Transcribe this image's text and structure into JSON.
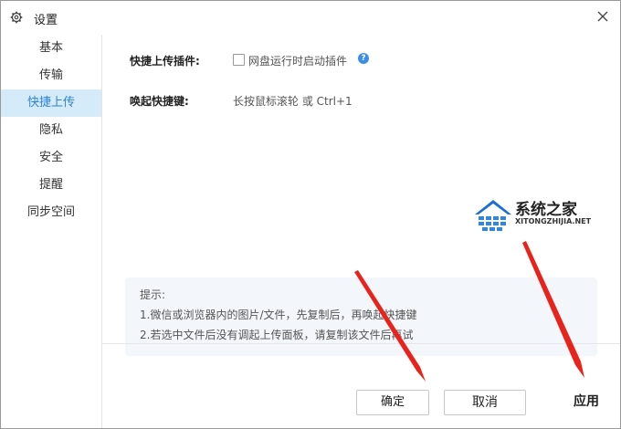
{
  "window": {
    "title": "设置",
    "icons": {
      "settings": "gear-icon",
      "close": "close-icon",
      "help": "question-icon"
    }
  },
  "sidebar": {
    "items": [
      {
        "label": "基本",
        "active": false
      },
      {
        "label": "传输",
        "active": false
      },
      {
        "label": "快捷上传",
        "active": true
      },
      {
        "label": "隐私",
        "active": false
      },
      {
        "label": "安全",
        "active": false
      },
      {
        "label": "提醒",
        "active": false
      },
      {
        "label": "同步空间",
        "active": false
      }
    ]
  },
  "main": {
    "plugin_label": "快捷上传插件:",
    "plugin_checkbox_label": "网盘运行时启动插件",
    "plugin_checked": false,
    "hotkey_label": "唤起快捷键:",
    "hotkey_value": "长按鼠标滚轮 或 Ctrl+1",
    "tips": {
      "heading": "提示:",
      "line1": "1.微信或浏览器内的图片/文件，先复制后，再唤起快捷键",
      "line2": "2.若选中文件后没有调起上传面板，请复制该文件后再试"
    }
  },
  "footer": {
    "ok_label": "确定",
    "cancel_label": "取消",
    "apply_label": "应用"
  },
  "watermark": {
    "name": "系统之家",
    "domain": "XITONGZHIJIA.NET"
  },
  "colors": {
    "accent": "#2a83d9",
    "active_bg": "#d6ebfa",
    "arrow": "#e8231c"
  }
}
